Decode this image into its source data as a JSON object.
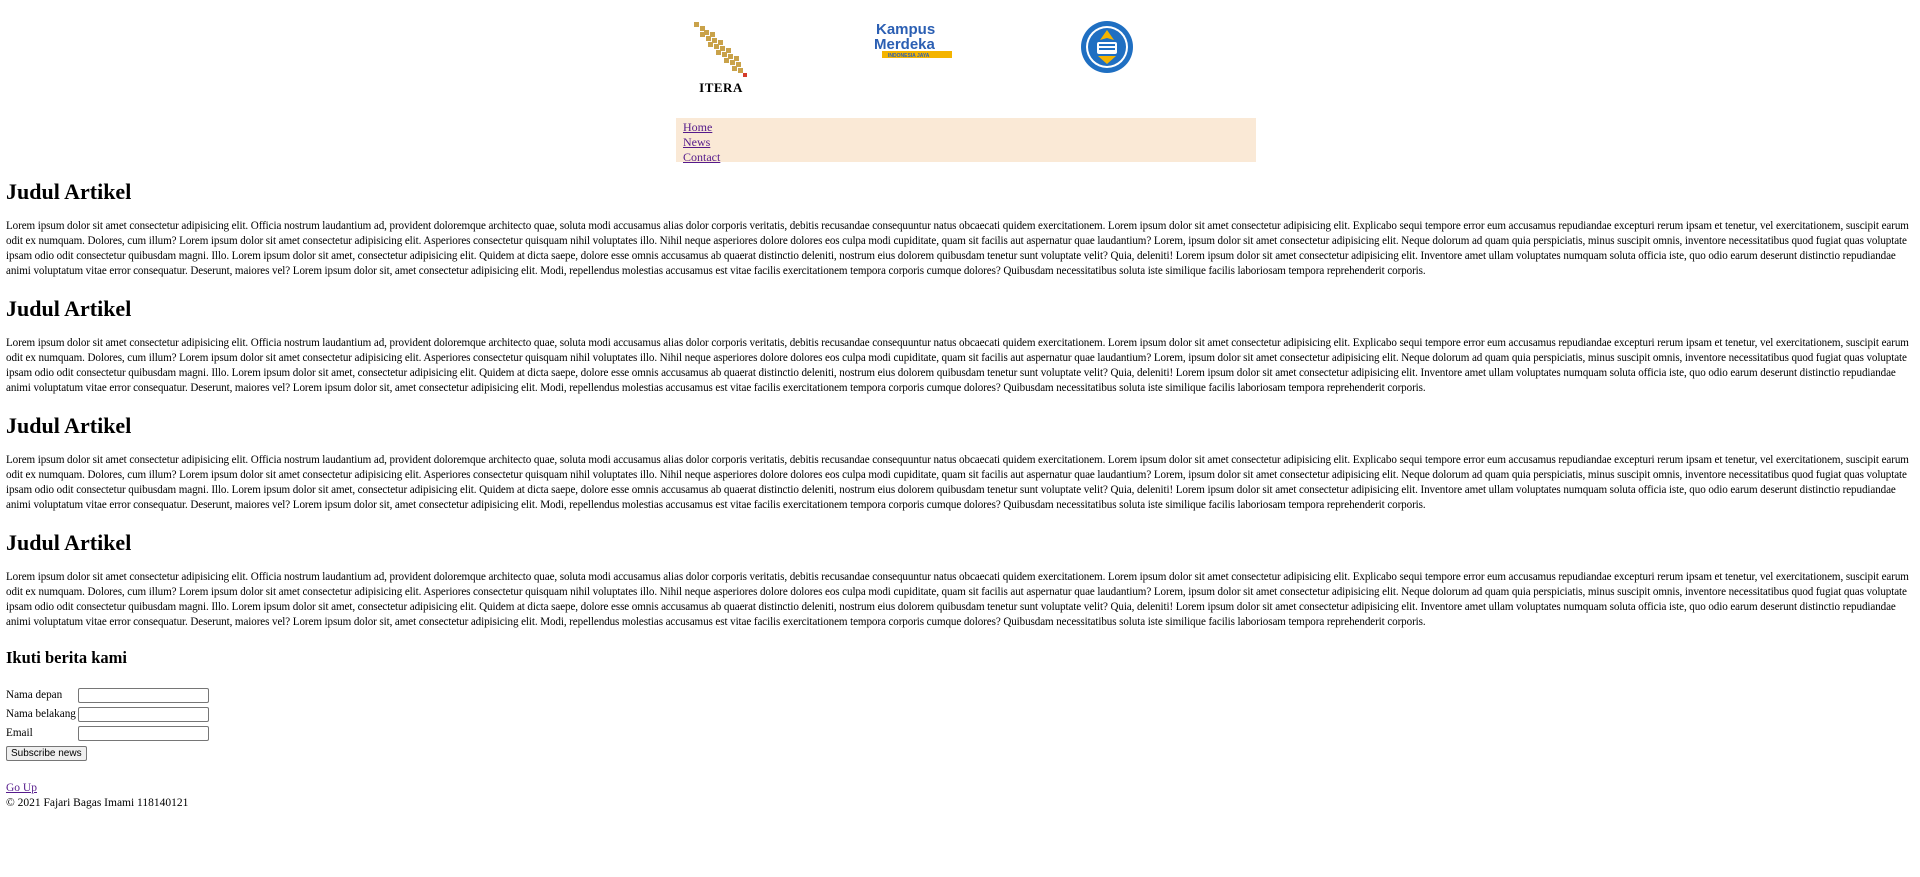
{
  "header": {
    "logos": {
      "itera": {
        "icon": "itera-logo",
        "text": "ITERA"
      },
      "kampus_merdeka": {
        "icon": "kampus-merdeka-logo",
        "line1": "Kampus",
        "line2": "Merdeka",
        "tag": "INDONESIA JAYA"
      },
      "tut_wuri": {
        "icon": "tut-wuri-handayani-logo"
      }
    }
  },
  "nav": {
    "items": [
      {
        "label": "Home"
      },
      {
        "label": "News"
      },
      {
        "label": "Contact"
      }
    ]
  },
  "articles": [
    {
      "title": "Judul Artikel",
      "body": "Lorem ipsum dolor sit amet consectetur adipisicing elit. Officia nostrum laudantium ad, provident doloremque architecto quae, soluta modi accusamus alias dolor corporis veritatis, debitis recusandae consequuntur natus obcaecati quidem exercitationem. Lorem ipsum dolor sit amet consectetur adipisicing elit. Explicabo sequi tempore error eum accusamus repudiandae excepturi rerum ipsam et tenetur, vel exercitationem, suscipit earum odit ex numquam. Dolores, cum illum? Lorem ipsum dolor sit amet consectetur adipisicing elit. Asperiores consectetur quisquam nihil voluptates illo. Nihil neque asperiores dolore dolores eos culpa modi cupiditate, quam sit facilis aut aspernatur quae laudantium? Lorem, ipsum dolor sit amet consectetur adipisicing elit. Neque dolorum ad quam quia perspiciatis, minus suscipit omnis, inventore necessitatibus quod fugiat quas voluptate ipsam odio odit consectetur quibusdam magni. Illo. Lorem ipsum dolor sit amet, consectetur adipisicing elit. Quidem at dicta saepe, dolore esse omnis accusamus ab quaerat distinctio deleniti, nostrum eius dolorem quibusdam tenetur sunt voluptate velit? Quia, deleniti! Lorem ipsum dolor sit amet consectetur adipisicing elit. Inventore amet ullam voluptates numquam soluta officia iste, quo odio earum deserunt distinctio repudiandae animi voluptatum vitae error consequatur. Deserunt, maiores vel? Lorem ipsum dolor sit, amet consectetur adipisicing elit. Modi, repellendus molestias accusamus est vitae facilis exercitationem tempora corporis cumque dolores? Quibusdam necessitatibus soluta iste similique facilis laboriosam tempora reprehenderit corporis."
    },
    {
      "title": "Judul Artikel",
      "body": "Lorem ipsum dolor sit amet consectetur adipisicing elit. Officia nostrum laudantium ad, provident doloremque architecto quae, soluta modi accusamus alias dolor corporis veritatis, debitis recusandae consequuntur natus obcaecati quidem exercitationem. Lorem ipsum dolor sit amet consectetur adipisicing elit. Explicabo sequi tempore error eum accusamus repudiandae excepturi rerum ipsam et tenetur, vel exercitationem, suscipit earum odit ex numquam. Dolores, cum illum? Lorem ipsum dolor sit amet consectetur adipisicing elit. Asperiores consectetur quisquam nihil voluptates illo. Nihil neque asperiores dolore dolores eos culpa modi cupiditate, quam sit facilis aut aspernatur quae laudantium? Lorem, ipsum dolor sit amet consectetur adipisicing elit. Neque dolorum ad quam quia perspiciatis, minus suscipit omnis, inventore necessitatibus quod fugiat quas voluptate ipsam odio odit consectetur quibusdam magni. Illo. Lorem ipsum dolor sit amet, consectetur adipisicing elit. Quidem at dicta saepe, dolore esse omnis accusamus ab quaerat distinctio deleniti, nostrum eius dolorem quibusdam tenetur sunt voluptate velit? Quia, deleniti! Lorem ipsum dolor sit amet consectetur adipisicing elit. Inventore amet ullam voluptates numquam soluta officia iste, quo odio earum deserunt distinctio repudiandae animi voluptatum vitae error consequatur. Deserunt, maiores vel? Lorem ipsum dolor sit, amet consectetur adipisicing elit. Modi, repellendus molestias accusamus est vitae facilis exercitationem tempora corporis cumque dolores? Quibusdam necessitatibus soluta iste similique facilis laboriosam tempora reprehenderit corporis."
    },
    {
      "title": "Judul Artikel",
      "body": "Lorem ipsum dolor sit amet consectetur adipisicing elit. Officia nostrum laudantium ad, provident doloremque architecto quae, soluta modi accusamus alias dolor corporis veritatis, debitis recusandae consequuntur natus obcaecati quidem exercitationem. Lorem ipsum dolor sit amet consectetur adipisicing elit. Explicabo sequi tempore error eum accusamus repudiandae excepturi rerum ipsam et tenetur, vel exercitationem, suscipit earum odit ex numquam. Dolores, cum illum? Lorem ipsum dolor sit amet consectetur adipisicing elit. Asperiores consectetur quisquam nihil voluptates illo. Nihil neque asperiores dolore dolores eos culpa modi cupiditate, quam sit facilis aut aspernatur quae laudantium? Lorem, ipsum dolor sit amet consectetur adipisicing elit. Neque dolorum ad quam quia perspiciatis, minus suscipit omnis, inventore necessitatibus quod fugiat quas voluptate ipsam odio odit consectetur quibusdam magni. Illo. Lorem ipsum dolor sit amet, consectetur adipisicing elit. Quidem at dicta saepe, dolore esse omnis accusamus ab quaerat distinctio deleniti, nostrum eius dolorem quibusdam tenetur sunt voluptate velit? Quia, deleniti! Lorem ipsum dolor sit amet consectetur adipisicing elit. Inventore amet ullam voluptates numquam soluta officia iste, quo odio earum deserunt distinctio repudiandae animi voluptatum vitae error consequatur. Deserunt, maiores vel? Lorem ipsum dolor sit, amet consectetur adipisicing elit. Modi, repellendus molestias accusamus est vitae facilis exercitationem tempora corporis cumque dolores? Quibusdam necessitatibus soluta iste similique facilis laboriosam tempora reprehenderit corporis."
    },
    {
      "title": "Judul Artikel",
      "body": "Lorem ipsum dolor sit amet consectetur adipisicing elit. Officia nostrum laudantium ad, provident doloremque architecto quae, soluta modi accusamus alias dolor corporis veritatis, debitis recusandae consequuntur natus obcaecati quidem exercitationem. Lorem ipsum dolor sit amet consectetur adipisicing elit. Explicabo sequi tempore error eum accusamus repudiandae excepturi rerum ipsam et tenetur, vel exercitationem, suscipit earum odit ex numquam. Dolores, cum illum? Lorem ipsum dolor sit amet consectetur adipisicing elit. Asperiores consectetur quisquam nihil voluptates illo. Nihil neque asperiores dolore dolores eos culpa modi cupiditate, quam sit facilis aut aspernatur quae laudantium? Lorem, ipsum dolor sit amet consectetur adipisicing elit. Neque dolorum ad quam quia perspiciatis, minus suscipit omnis, inventore necessitatibus quod fugiat quas voluptate ipsam odio odit consectetur quibusdam magni. Illo. Lorem ipsum dolor sit amet, consectetur adipisicing elit. Quidem at dicta saepe, dolore esse omnis accusamus ab quaerat distinctio deleniti, nostrum eius dolorem quibusdam tenetur sunt voluptate velit? Quia, deleniti! Lorem ipsum dolor sit amet consectetur adipisicing elit. Inventore amet ullam voluptates numquam soluta officia iste, quo odio earum deserunt distinctio repudiandae animi voluptatum vitae error consequatur. Deserunt, maiores vel? Lorem ipsum dolor sit, amet consectetur adipisicing elit. Modi, repellendus molestias accusamus est vitae facilis exercitationem tempora corporis cumque dolores? Quibusdam necessitatibus soluta iste similique facilis laboriosam tempora reprehenderit corporis."
    }
  ],
  "subscribe": {
    "title": "Ikuti berita kami",
    "fields": [
      {
        "label": "Nama depan",
        "value": ""
      },
      {
        "label": "Nama belakang",
        "value": ""
      },
      {
        "label": "Email",
        "value": ""
      }
    ],
    "button_label": "Subscribe news"
  },
  "footer": {
    "go_up": "Go Up",
    "copyright": "© 2021 Fajari Bagas Imami 118140121"
  },
  "colors": {
    "nav_background": "#fae9d6",
    "link": "#551a8b",
    "itera_gold": "#c9a24a",
    "km_blue": "#2b5fb3",
    "km_yellow": "#f4b400",
    "tw_blue": "#1f6fc2"
  }
}
